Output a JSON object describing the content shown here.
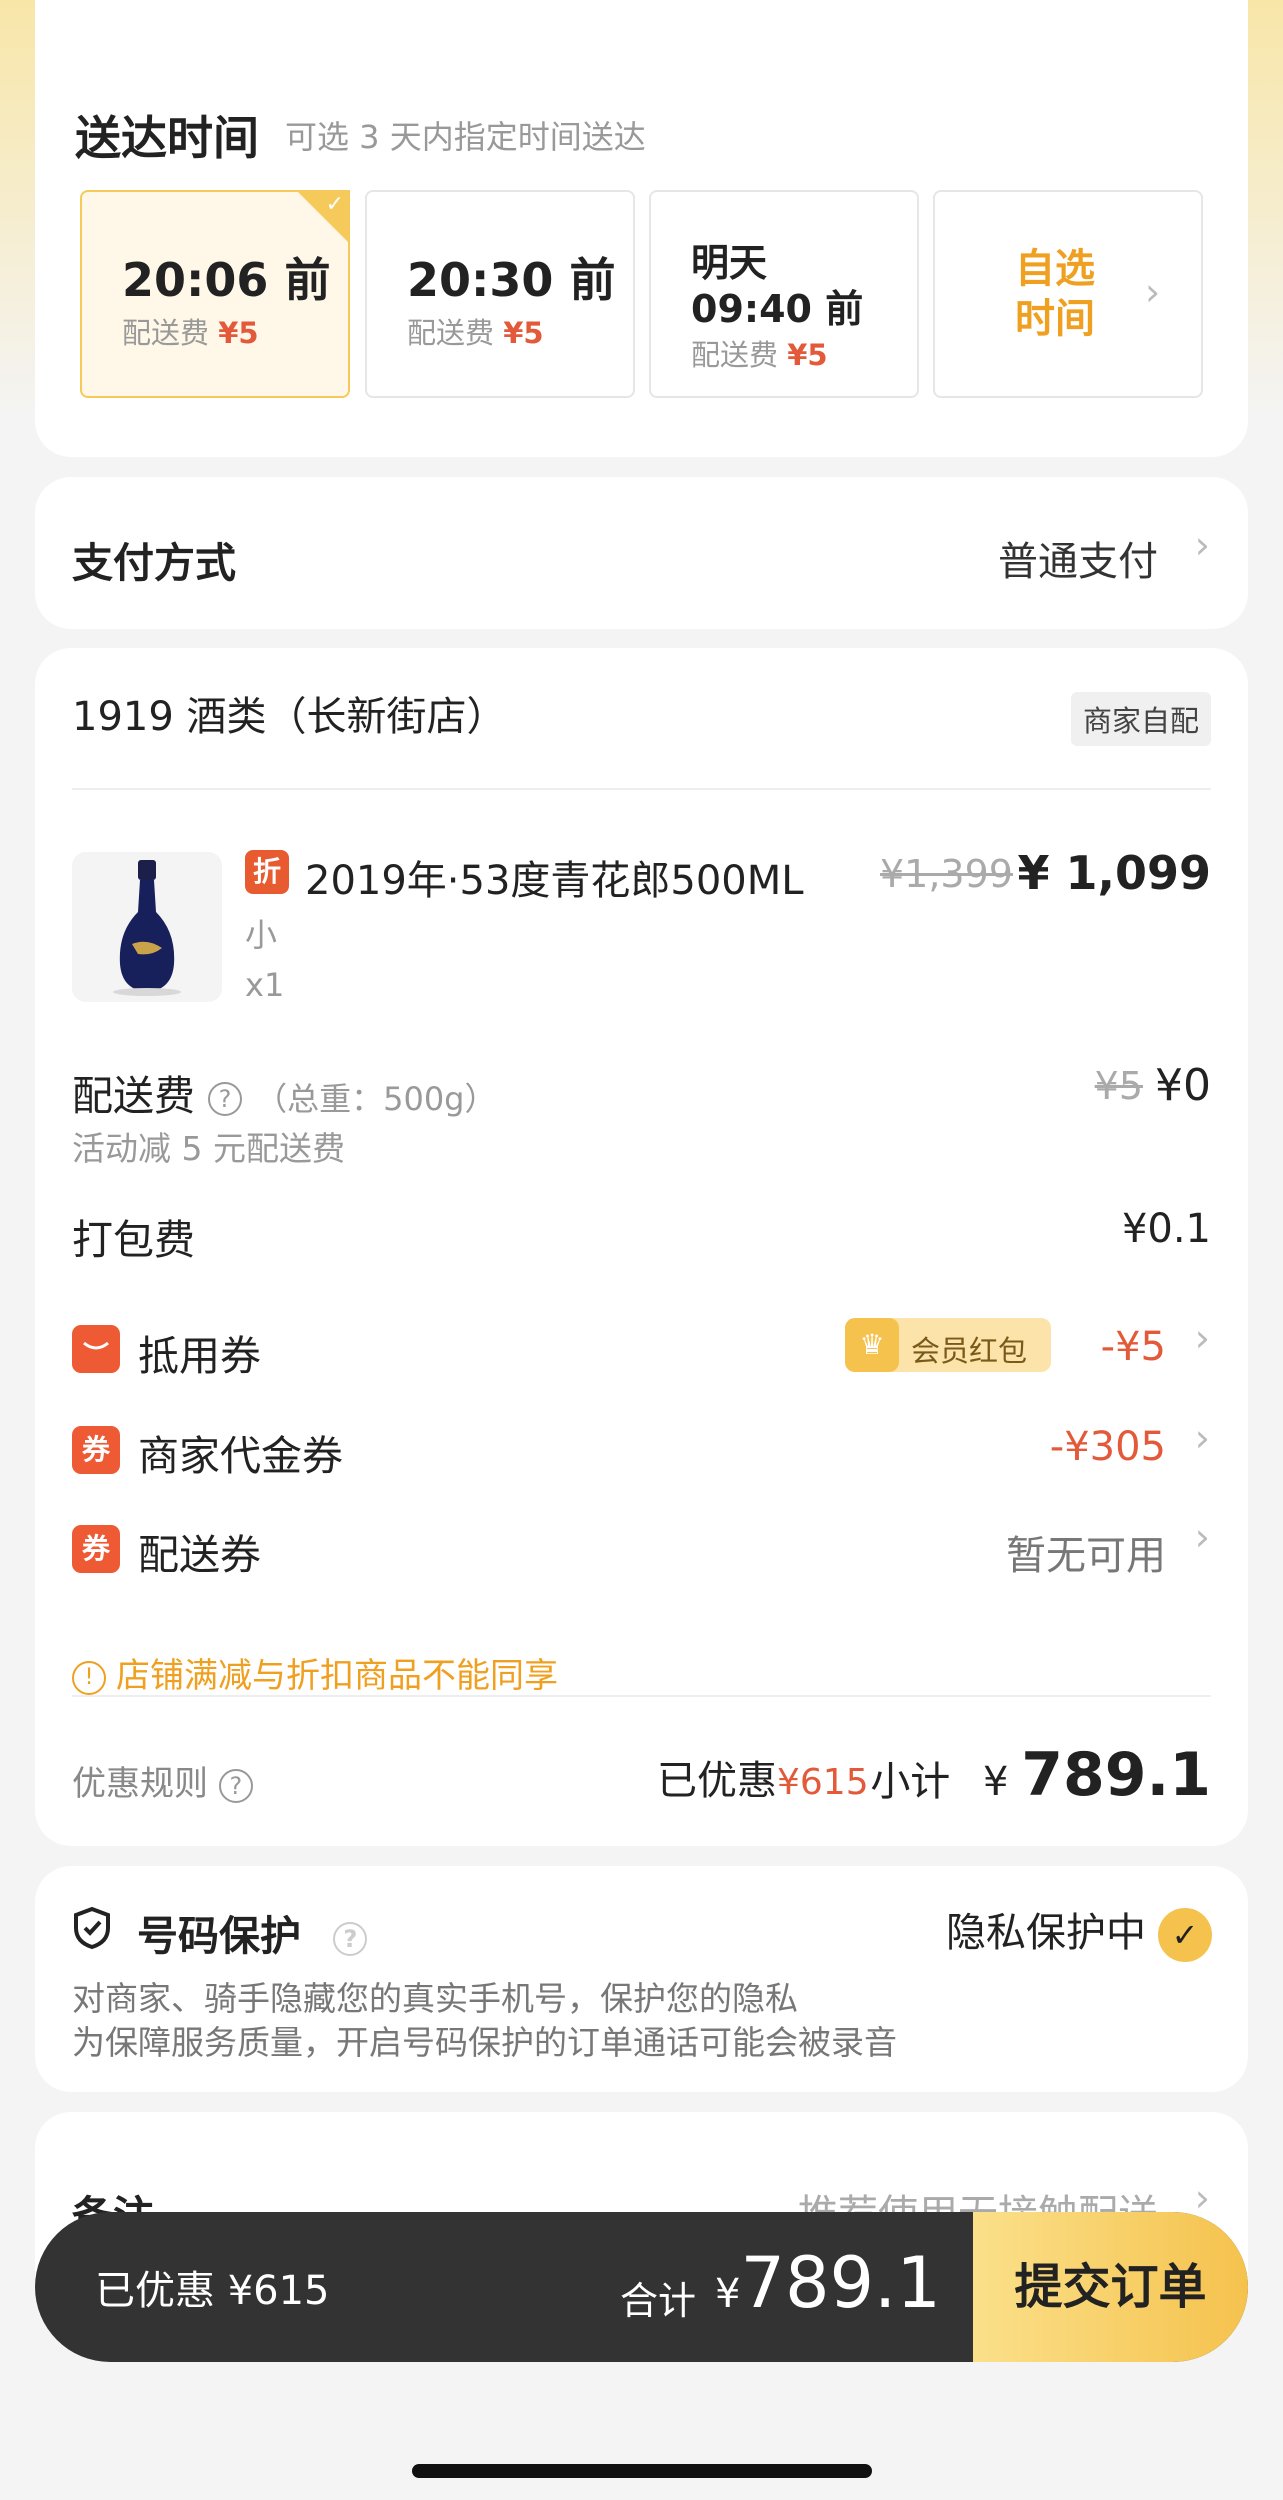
{
  "delivery": {
    "title": "送达时间",
    "subtitle": "可选 3 天内指定时间送达",
    "fee_label": "配送费",
    "slots": [
      {
        "line1": "20:06 前",
        "fee_price": "¥5",
        "selected": true
      },
      {
        "line1": "20:30 前",
        "fee_price": "¥5",
        "selected": false
      },
      {
        "line0": "明天",
        "line1": "09:40 前",
        "fee_price": "¥5",
        "selected": false
      }
    ],
    "custom_line1": "自选",
    "custom_line2": "时间"
  },
  "payment": {
    "title": "支付方式",
    "value": "普通支付"
  },
  "order": {
    "shop_name": "1919 酒类（长新街店）",
    "shop_tag": "商家自配",
    "product": {
      "badge": "折",
      "name": "2019年·53度青花郎500ML",
      "spec": "小",
      "qty": "x1",
      "price_old": "¥1,399",
      "price_new": "¥ 1,099"
    },
    "delivery_fee": {
      "label": "配送费",
      "weight": "（总重：500g）",
      "note": "活动减 5 元配送费",
      "price_old": "¥5",
      "price_new": "¥0"
    },
    "packing_fee": {
      "label": "打包费",
      "value": "¥0.1"
    },
    "coupon": {
      "label": "抵用券",
      "tag": "会员红包",
      "value": "-¥5"
    },
    "merchant_voucher": {
      "icon_text": "券",
      "label": "商家代金券",
      "value": "-¥305"
    },
    "delivery_voucher": {
      "icon_text": "券",
      "label": "配送券",
      "value": "暂无可用"
    },
    "warning": "店铺满减与折扣商品不能同享",
    "rules_label": "优惠规则",
    "discounted_label": "已优惠",
    "discounted_value": "¥615",
    "subtotal_label": "小计",
    "subtotal_currency": "¥",
    "subtotal_value": "789.1"
  },
  "protect": {
    "title": "号码保护",
    "status": "隐私保护中",
    "desc1": "对商家、骑手隐藏您的真实手机号，保护您的隐私",
    "desc2": "为保障服务质量，开启号码保护的订单通话可能会被录音"
  },
  "remark": {
    "label": "备注",
    "value": "推荐使用无接触配送"
  },
  "bottom": {
    "discount": "已优惠 ¥615",
    "total_label": "合计",
    "total_currency": "¥",
    "total_value": "789.1",
    "submit": "提交订单"
  },
  "colors": {
    "accent_red": "#e25a3a",
    "accent_yellow": "#f5c24d",
    "warn_orange": "#f0a020"
  }
}
